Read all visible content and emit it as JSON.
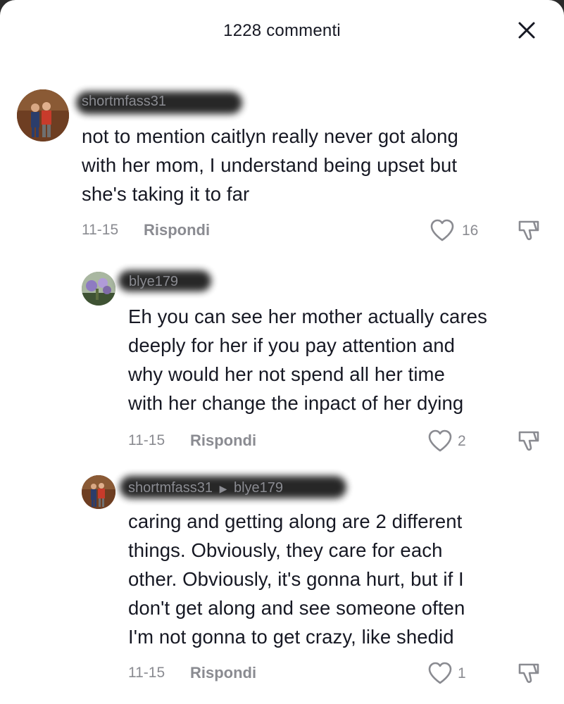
{
  "header": {
    "title": "1228 commenti"
  },
  "comments": [
    {
      "username": "shortmfass31",
      "text_lines": [
        "not to mention caitlyn really never got along",
        "with her mom, I understand being upset but",
        "she's taking it to far"
      ],
      "date": "11-15",
      "reply_label": "Rispondi",
      "likes": "16"
    },
    {
      "username": "blye179",
      "text_lines": [
        "Eh you can see her mother actually cares",
        "deeply for her if you pay attention and",
        "why would her not spend all her time",
        "with her change the inpact of her dying"
      ],
      "date": "11-15",
      "reply_label": "Rispondi",
      "likes": "2"
    },
    {
      "username": "shortmfass31",
      "reply_to": "blye179",
      "text_lines": [
        "caring and getting along are 2 different",
        "things. Obviously, they care for each",
        "other. Obviously, it's gonna hurt, but if I",
        "don't get along and see someone often",
        "I'm not gonna to get crazy, like shedid"
      ],
      "date": "11-15",
      "reply_label": "Rispondi",
      "likes": "1"
    }
  ],
  "icons": {
    "close": "close-icon",
    "like": "heart-outline-icon",
    "dislike": "thumbs-down-icon",
    "reply_arrow": "caret-right-icon"
  },
  "colors": {
    "text": "#161823",
    "muted": "#8a8b91",
    "background": "#ffffff"
  }
}
